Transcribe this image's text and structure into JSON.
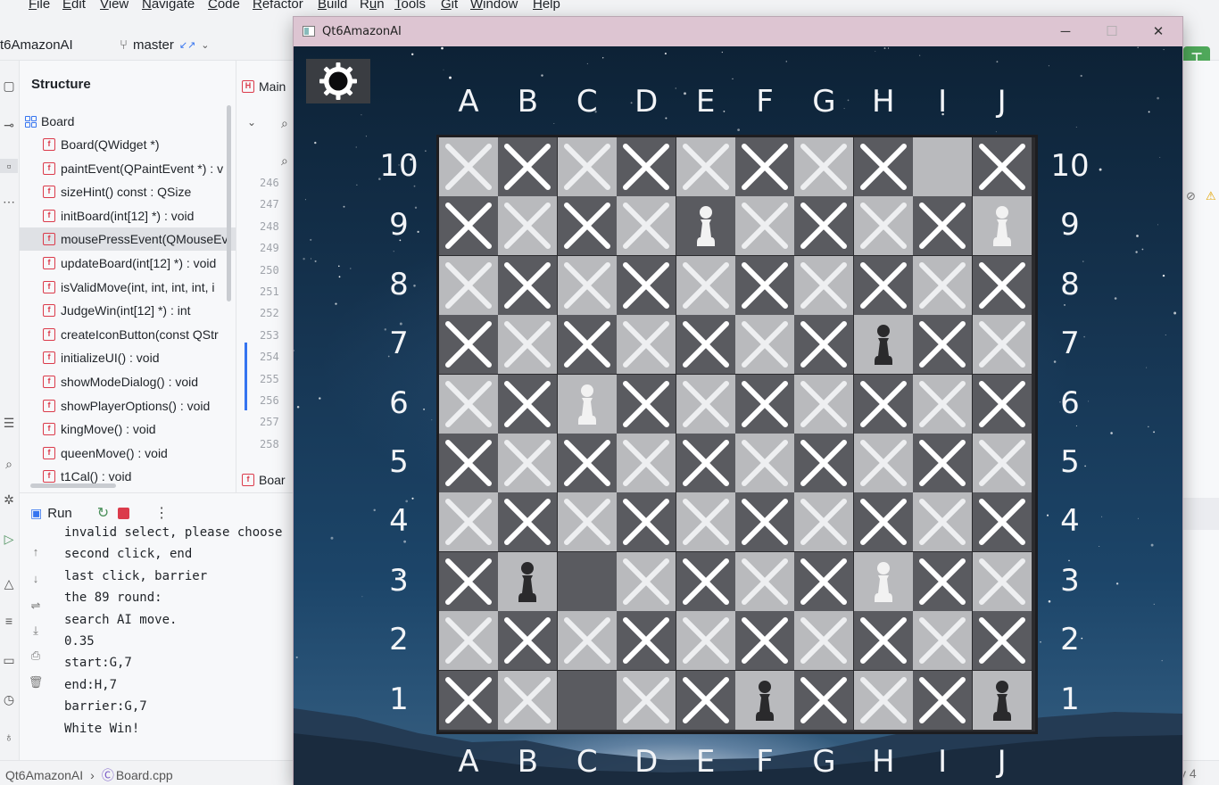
{
  "ide": {
    "menu": [
      "File",
      "Edit",
      "View",
      "Navigate",
      "Code",
      "Refactor",
      "Build",
      "Run",
      "Tools",
      "Git",
      "Window",
      "Help"
    ],
    "menu_mnemonic": [
      "F",
      "E",
      "V",
      "N",
      "C",
      "R",
      "B",
      "u",
      "T",
      "G",
      "W",
      "H"
    ],
    "project_name": "t6AmazonAI",
    "branch": "master",
    "structure": {
      "title": "Structure",
      "root": "Board",
      "items": [
        "Board(QWidget *)",
        "paintEvent(QPaintEvent *) : v",
        "sizeHint() const : QSize",
        "initBoard(int[12] *) : void",
        "mousePressEvent(QMouseEv",
        "updateBoard(int[12] *) : void",
        "isValidMove(int, int, int, int, i",
        "JudgeWin(int[12] *) : int",
        "createIconButton(const QStr",
        "initializeUI() : void",
        "showModeDialog() : void",
        "showPlayerOptions() : void",
        "kingMove() : void",
        "queenMove() : void",
        "t1Cal() : void"
      ],
      "selected_index": 4
    },
    "editor": {
      "tab_label": "Main",
      "bottom_tab_label": "Boar",
      "line_numbers": [
        "246",
        "247",
        "248",
        "249",
        "250",
        "251",
        "252",
        "253",
        "254",
        "255",
        "256",
        "257",
        "258"
      ]
    },
    "run": {
      "label": "Run",
      "console": [
        "invalid select, please choose",
        "second click, end",
        "last click, barrier",
        "the 89 round:",
        "search AI move.",
        "0.35",
        "start:G,7",
        "end:H,7",
        "barrier:G,7",
        "White Win!"
      ]
    },
    "status": {
      "crumbs": [
        "Qt6AmazonAI",
        "Board.cpp"
      ],
      "right_text": "y  4"
    }
  },
  "app": {
    "title": "Qt6AmazonAI",
    "controls": {
      "minimize": "─",
      "maximize": "☐",
      "close": "✕"
    },
    "columns": [
      "A",
      "B",
      "C",
      "D",
      "E",
      "F",
      "G",
      "H",
      "I",
      "J"
    ],
    "rows": [
      "10",
      "9",
      "8",
      "7",
      "6",
      "5",
      "4",
      "3",
      "2",
      "1"
    ],
    "board_legend": {
      "X": "blocked",
      ".": "empty",
      "W": "white amazon",
      "B": "black amazon"
    },
    "board": [
      "XXXXXXXX.X",
      "XXXXWXXXXW",
      "XXXXXXXXXX",
      "XXXXXXXBXX",
      "XXWXXXXXXX",
      "XXXXXXXXXX",
      "XXXXXXXXXX",
      "XB.XXXXWXX",
      "XXXXXXXXXX",
      "XX.XXBXXXB"
    ],
    "colors": {
      "light_square": "#b9babd",
      "dark_square": "#5a5b60",
      "cross_on_light": "#eeeff1",
      "cross_on_dark": "#ffffff",
      "white_piece": "#f2f2f2",
      "black_piece": "#2a2a2c"
    }
  }
}
